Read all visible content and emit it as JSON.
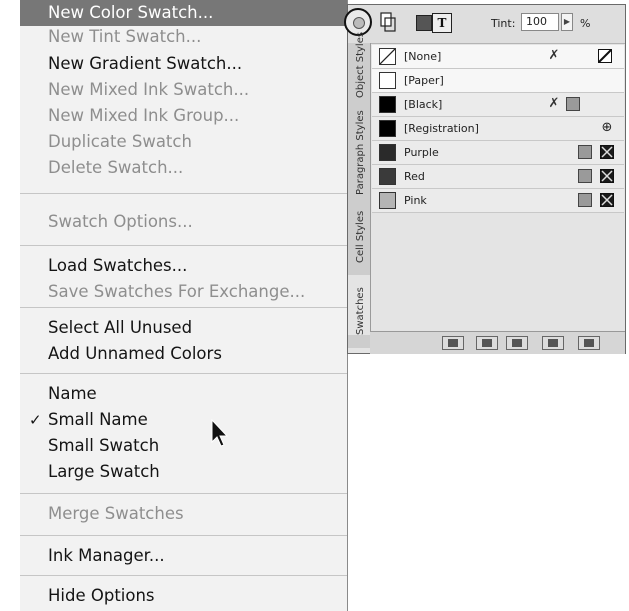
{
  "menu": {
    "items": [
      {
        "label": "New Color Swatch...",
        "state": "highlighted"
      },
      {
        "label": "New Tint Swatch...",
        "state": "disabled"
      },
      {
        "label": "New Gradient Swatch...",
        "state": "enabled"
      },
      {
        "label": "New Mixed Ink Swatch...",
        "state": "disabled"
      },
      {
        "label": "New Mixed Ink Group...",
        "state": "disabled"
      },
      {
        "label": "Duplicate Swatch",
        "state": "disabled"
      },
      {
        "label": "Delete Swatch...",
        "state": "disabled"
      },
      {
        "label": "Swatch Options...",
        "state": "disabled"
      },
      {
        "label": "Load Swatches...",
        "state": "enabled"
      },
      {
        "label": "Save Swatches For Exchange...",
        "state": "disabled"
      },
      {
        "label": "Select All Unused",
        "state": "enabled"
      },
      {
        "label": "Add Unnamed Colors",
        "state": "enabled"
      },
      {
        "label": "Name",
        "state": "enabled"
      },
      {
        "label": "Small Name",
        "state": "enabled"
      },
      {
        "label": "Small Swatch",
        "state": "enabled"
      },
      {
        "label": "Large Swatch",
        "state": "enabled"
      },
      {
        "label": "Merge Swatches",
        "state": "disabled"
      },
      {
        "label": "Ink Manager...",
        "state": "enabled"
      },
      {
        "label": "Hide Options",
        "state": "enabled"
      }
    ],
    "checkmark": "✓"
  },
  "panel": {
    "tint_label": "Tint:",
    "tint_value": "100",
    "tint_percent": "%",
    "format_text_glyph": "T",
    "tabs": [
      "Swatches",
      "Cell Styles",
      "Paragraph Styles",
      "Object Styles"
    ],
    "swatches": [
      {
        "name": "[None]",
        "color": "none"
      },
      {
        "name": "[Paper]",
        "color": "#ffffff"
      },
      {
        "name": "[Black]",
        "color": "#000000"
      },
      {
        "name": "[Registration]",
        "color": "#000000"
      },
      {
        "name": "Purple",
        "color": "#2a2a2a"
      },
      {
        "name": "Red",
        "color": "#3a3a3a"
      },
      {
        "name": "Pink",
        "color": "#b4b4b4"
      }
    ]
  }
}
